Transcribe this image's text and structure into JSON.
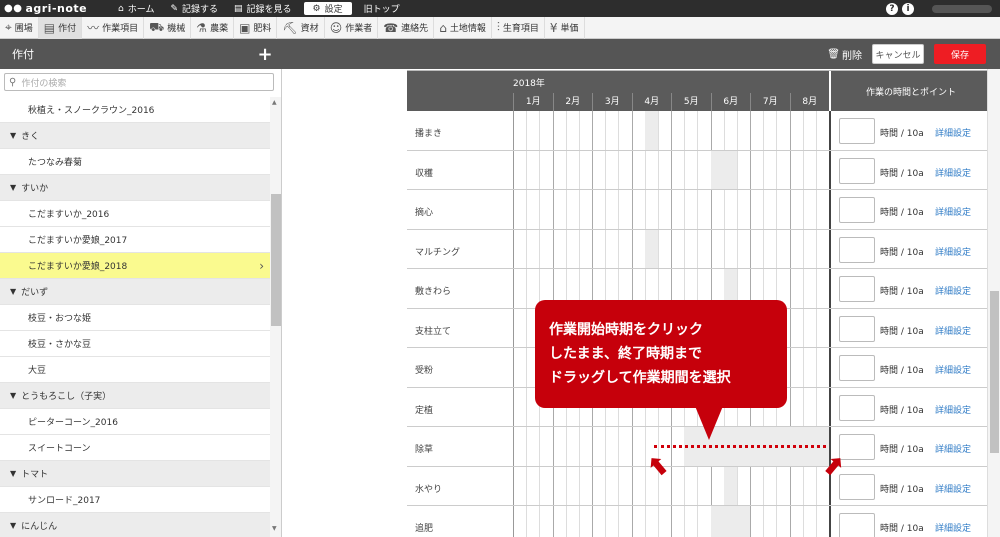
{
  "app": {
    "logo": "agri-note"
  },
  "topnav": {
    "home": "ホーム",
    "record": "記録する",
    "view": "記録を見る",
    "settings": "設定",
    "old_top": "旧トップ"
  },
  "toolbar": {
    "items": [
      "圃場",
      "作付",
      "作業項目",
      "機械",
      "農薬",
      "肥料",
      "資材",
      "作業者",
      "連絡先",
      "土地情報",
      "生育項目",
      "単価"
    ]
  },
  "header": {
    "title": "作付",
    "add": "+",
    "delete": "削除",
    "cancel": "キャンセル",
    "save": "保存"
  },
  "search": {
    "placeholder": "作付の検索"
  },
  "sidebar": {
    "items": [
      {
        "type": "item",
        "label": "秋植え・スノークラウン_2016"
      },
      {
        "type": "cat",
        "label": "きく"
      },
      {
        "type": "item",
        "label": "たつなみ春菊"
      },
      {
        "type": "cat",
        "label": "すいか"
      },
      {
        "type": "item",
        "label": "こだますいか_2016"
      },
      {
        "type": "item",
        "label": "こだますいか愛娘_2017"
      },
      {
        "type": "item",
        "label": "こだますいか愛娘_2018",
        "active": true
      },
      {
        "type": "cat",
        "label": "だいず"
      },
      {
        "type": "item",
        "label": "枝豆・おつな姫"
      },
      {
        "type": "item",
        "label": "枝豆・さかな豆"
      },
      {
        "type": "item",
        "label": "大豆"
      },
      {
        "type": "cat",
        "label": "とうもろこし（子実）"
      },
      {
        "type": "item",
        "label": "ピーターコーン_2016"
      },
      {
        "type": "item",
        "label": "スイートコーン"
      },
      {
        "type": "cat",
        "label": "トマト"
      },
      {
        "type": "item",
        "label": "サンロード_2017"
      },
      {
        "type": "cat",
        "label": "にんじん"
      }
    ]
  },
  "schedule": {
    "year": "2018年",
    "months": [
      "1月",
      "2月",
      "3月",
      "4月",
      "5月",
      "6月",
      "7月",
      "8月"
    ],
    "points_header": "作業の時間とポイント",
    "unit": "時間 / 10a",
    "detail": "詳細設定",
    "tasks": [
      {
        "name": "播まき",
        "periods": [
          [
            10,
            11
          ]
        ]
      },
      {
        "name": "収穫",
        "periods": [
          [
            15,
            17
          ]
        ]
      },
      {
        "name": "摘心",
        "periods": []
      },
      {
        "name": "マルチング",
        "periods": [
          [
            10,
            11
          ]
        ]
      },
      {
        "name": "敷きわら",
        "periods": [
          [
            16,
            17
          ]
        ]
      },
      {
        "name": "支柱立て",
        "periods": []
      },
      {
        "name": "受粉",
        "periods": []
      },
      {
        "name": "定植",
        "periods": []
      },
      {
        "name": "除草",
        "periods": [
          [
            13,
            24
          ]
        ]
      },
      {
        "name": "水やり",
        "periods": [
          [
            16,
            17
          ]
        ]
      },
      {
        "name": "追肥",
        "periods": [
          [
            15,
            18
          ]
        ]
      }
    ]
  },
  "callout": {
    "lines": [
      "作業開始時期をクリック",
      "したまま、終了時期まで",
      "ドラッグして作業期間を選択"
    ]
  }
}
